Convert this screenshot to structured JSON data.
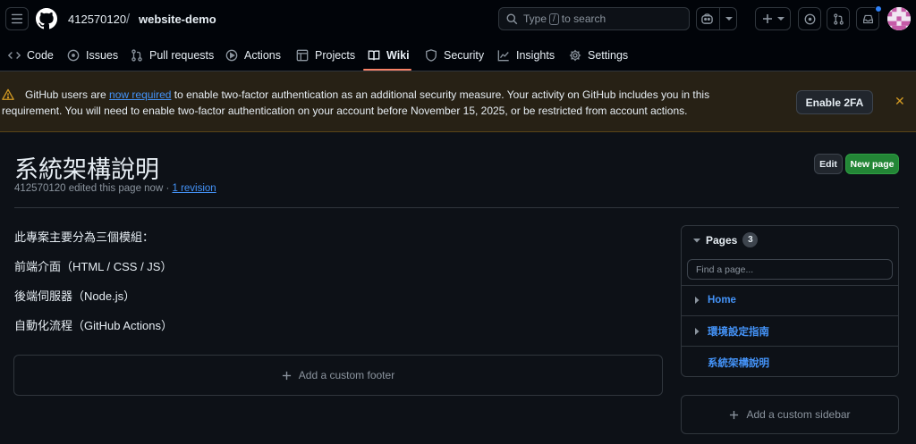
{
  "header": {
    "owner": "412570120",
    "separator": "/",
    "repo": "website-demo",
    "search": {
      "prefix": "Type",
      "key": "/",
      "suffix": "to search"
    }
  },
  "tabs": [
    {
      "label": "Code",
      "icon": "code-icon"
    },
    {
      "label": "Issues",
      "icon": "issue-icon"
    },
    {
      "label": "Pull requests",
      "icon": "pull-request-icon"
    },
    {
      "label": "Actions",
      "icon": "play-icon"
    },
    {
      "label": "Projects",
      "icon": "table-icon"
    },
    {
      "label": "Wiki",
      "icon": "book-icon",
      "selected": true
    },
    {
      "label": "Security",
      "icon": "shield-icon"
    },
    {
      "label": "Insights",
      "icon": "graph-icon"
    },
    {
      "label": "Settings",
      "icon": "gear-icon"
    }
  ],
  "banner": {
    "before_link": "GitHub users are ",
    "link": "now required",
    "after_link": " to enable two-factor authentication as an additional security measure. Your activity on GitHub includes you in this requirement. You will need to enable two-factor authentication on your account before November 15, 2025, or be restricted from account actions.",
    "button": "Enable 2FA",
    "close": "✕"
  },
  "page": {
    "title": "系統架構說明",
    "meta_prefix": "412570120 edited this page now · ",
    "meta_link": "1 revision",
    "edit_label": "Edit",
    "new_page_label": "New page",
    "content": [
      "此專案主要分為三個模組：",
      "前端介面（HTML / CSS / JS）",
      "後端伺服器（Node.js）",
      "自動化流程（GitHub Actions）"
    ],
    "footer_label": "Add a custom footer"
  },
  "sidebar": {
    "pages_label": "Pages",
    "pages_count": "3",
    "find_placeholder": "Find a page...",
    "pages": [
      "Home",
      "環境設定指南",
      "系統架構說明"
    ],
    "custom_label": "Add a custom sidebar"
  },
  "colors": {
    "background": "#0d1117",
    "link": "#4493f8",
    "accent_underline": "#f78166",
    "primary_button": "#238636",
    "warning": "#d29922"
  }
}
